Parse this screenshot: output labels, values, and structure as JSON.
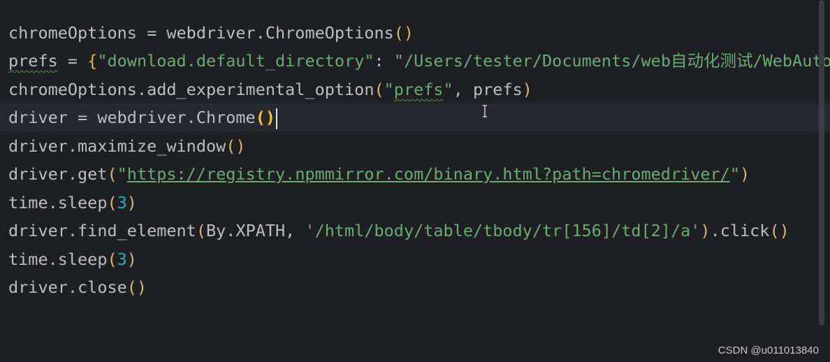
{
  "editor": {
    "lines": [
      [
        {
          "t": "chromeOptions = webdriver.ChromeOptions"
        },
        {
          "t": "()",
          "c": "paren"
        }
      ],
      [
        {
          "t": "prefs",
          "c": "squiggle"
        },
        {
          "t": " = "
        },
        {
          "t": "{",
          "c": "brace"
        },
        {
          "t": "\"download.default_directory\"",
          "c": "str"
        },
        {
          "t": ": "
        },
        {
          "t": "\"/Users/tester/Documents/web自动化测试/WebAuto",
          "c": "str"
        }
      ],
      [
        {
          "t": "chromeOptions.add_experimental_option"
        },
        {
          "t": "(",
          "c": "paren"
        },
        {
          "t": "\"",
          "c": "str"
        },
        {
          "t": "prefs",
          "c": "str squiggle"
        },
        {
          "t": "\"",
          "c": "str"
        },
        {
          "t": ", prefs"
        },
        {
          "t": ")",
          "c": "paren"
        }
      ],
      [
        {
          "t": "driver = webdriver.Chrome"
        },
        {
          "t": "()",
          "c": "paren-hl"
        },
        {
          "caret": true
        }
      ],
      [
        {
          "t": "driver.maximize_window"
        },
        {
          "t": "()",
          "c": "paren"
        }
      ],
      [
        {
          "t": "driver.get"
        },
        {
          "t": "(",
          "c": "paren"
        },
        {
          "t": "\"",
          "c": "str"
        },
        {
          "t": "https://registry.npmmirror.com/binary.html?path=chromedriver/",
          "c": "link"
        },
        {
          "t": "\"",
          "c": "str"
        },
        {
          "t": ")",
          "c": "paren"
        }
      ],
      [
        {
          "t": "time.sleep"
        },
        {
          "t": "(",
          "c": "paren"
        },
        {
          "t": "3",
          "c": "num"
        },
        {
          "t": ")",
          "c": "paren"
        }
      ],
      [
        {
          "t": "driver.find_element"
        },
        {
          "t": "(",
          "c": "paren"
        },
        {
          "t": "By.XPATH, "
        },
        {
          "t": "'/html/body/table/tbody/tr[156]/td[2]/a'",
          "c": "str"
        },
        {
          "t": ")",
          "c": "paren"
        },
        {
          "t": ".click"
        },
        {
          "t": "()",
          "c": "paren"
        }
      ],
      [
        {
          "t": "time.sleep"
        },
        {
          "t": "(",
          "c": "paren"
        },
        {
          "t": "3",
          "c": "num"
        },
        {
          "t": ")",
          "c": "paren"
        }
      ],
      [
        {
          "t": "driver.close"
        },
        {
          "t": "()",
          "c": "paren"
        }
      ]
    ]
  },
  "watermark": "CSDN @u011013840",
  "colors": {
    "background": "#1e1f22",
    "text": "#bcbec4",
    "string": "#6aab73",
    "number": "#2aacb8",
    "paren": "#d5b778"
  }
}
